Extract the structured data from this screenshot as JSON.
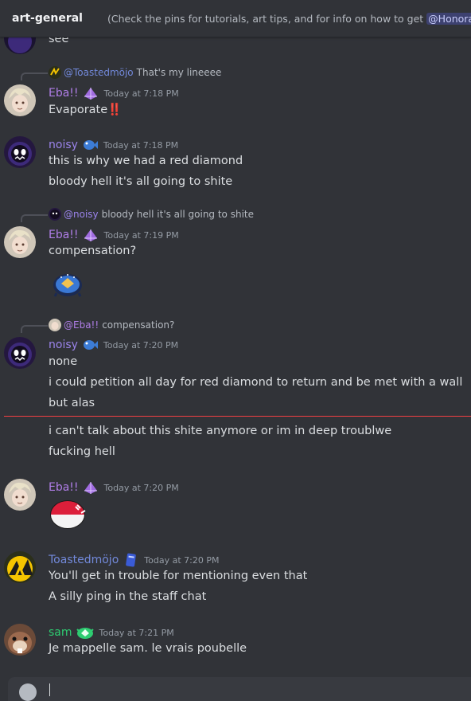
{
  "channel": {
    "name": "art-general",
    "topic": "(Check the pins for tutorials, art tips, and for info on how to get ",
    "topic_mention": "@Honora"
  },
  "messages": [
    {
      "id": "m0",
      "content": [
        "see"
      ]
    },
    {
      "id": "m1",
      "reply": {
        "author": "@Toastedmöjo",
        "text": "That's my lineeee"
      },
      "author": "Eba!!",
      "timestamp": "Today at 7:18 PM",
      "content_text": "Evaporate",
      "content_emoji": "‼️"
    },
    {
      "id": "m2",
      "author": "noisy",
      "timestamp": "Today at 7:18 PM",
      "content": [
        "this is why we had a red diamond",
        "bloody hell it's all going to shite"
      ]
    },
    {
      "id": "m3",
      "reply": {
        "author": "@noisy",
        "text": "bloody hell it's all going to shite"
      },
      "author": "Eba!!",
      "timestamp": "Today at 7:19 PM",
      "content": [
        "compensation?"
      ]
    },
    {
      "id": "m4",
      "reply": {
        "author": "@Eba!!",
        "text": "compensation?"
      },
      "author": "noisy",
      "timestamp": "Today at 7:20 PM",
      "content": [
        "none",
        "i could petition all day for red diamond to return and be met with a wall",
        "but alas"
      ],
      "continued": [
        "i can't talk about this shite anymore or im in deep troublwe",
        "fucking hell"
      ]
    },
    {
      "id": "m5",
      "author": "Eba!!",
      "timestamp": "Today at 7:20 PM"
    },
    {
      "id": "m6",
      "author": "Toastedmöjo",
      "timestamp": "Today at 7:20 PM",
      "content": [
        "You'll get in trouble for mentioning even that",
        "A silly ping in the staff chat"
      ]
    },
    {
      "id": "m7",
      "author": "sam",
      "timestamp": "Today at 7:21 PM",
      "content": [
        "Je mappelle sam. le vrais poubelle"
      ]
    }
  ],
  "colors": {
    "background": "#313338",
    "eba_name": "#b07ee8",
    "noisy_name": "#9b84ec",
    "toasted_name": "#7289da",
    "sam_name": "#2ecc71",
    "new_divider": "#f23f43",
    "mention": "#c9cdfb"
  },
  "icons": [
    "hashtag-icon",
    "purple-crystal-badge-icon",
    "blue-fish-badge-icon",
    "blue-card-badge-icon",
    "green-gem-badge-icon",
    "double-exclamation-emoji",
    "blue-crown-blob-sticker",
    "red-white-ball-sticker",
    "attach-plus-icon"
  ]
}
